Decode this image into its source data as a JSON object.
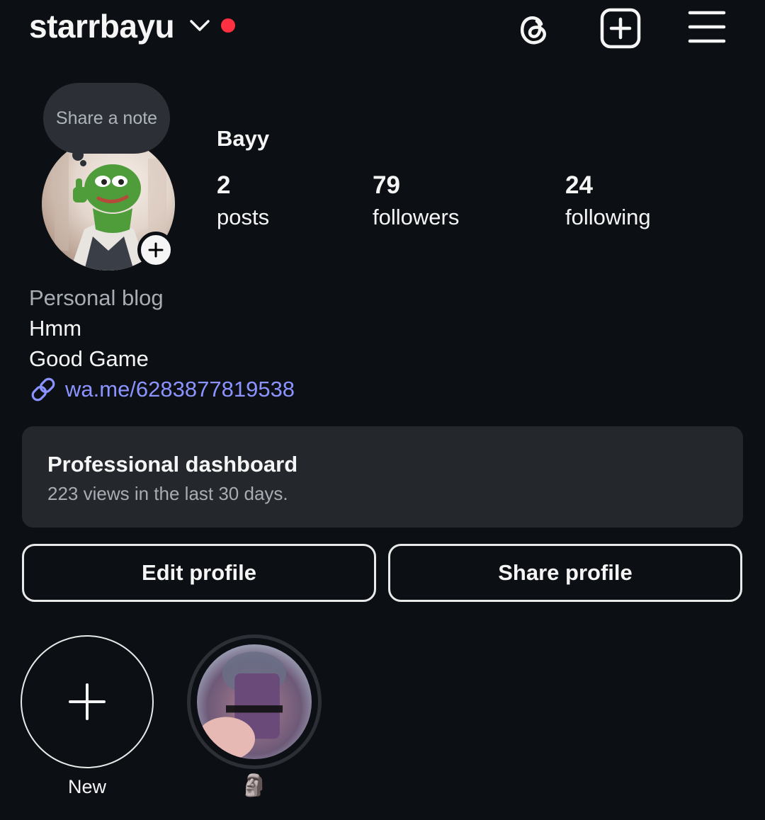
{
  "header": {
    "username": "starrbayu",
    "has_live_dot": true
  },
  "note": {
    "placeholder": "Share a note"
  },
  "profile": {
    "display_name": "Bayy",
    "stats": [
      {
        "value": "2",
        "label": "posts"
      },
      {
        "value": "79",
        "label": "followers"
      },
      {
        "value": "24",
        "label": "following"
      }
    ],
    "bio": {
      "category": "Personal blog",
      "lines": [
        "Hmm",
        "Good Game"
      ],
      "link": "wa.me/6283877819538"
    }
  },
  "dashboard": {
    "title": "Professional dashboard",
    "subtitle": "223 views in the last 30 days."
  },
  "buttons": {
    "edit": "Edit profile",
    "share": "Share profile"
  },
  "highlights": [
    {
      "label": "New"
    },
    {
      "label": "🗿"
    }
  ],
  "colors": {
    "background": "#0c1014",
    "link": "#8a93ff",
    "live_dot": "#ff3040",
    "card": "#24272c"
  },
  "icons": [
    "chevron-down-icon",
    "threads-icon",
    "create-post-icon",
    "hamburger-menu-icon",
    "link-icon",
    "plus-icon"
  ]
}
